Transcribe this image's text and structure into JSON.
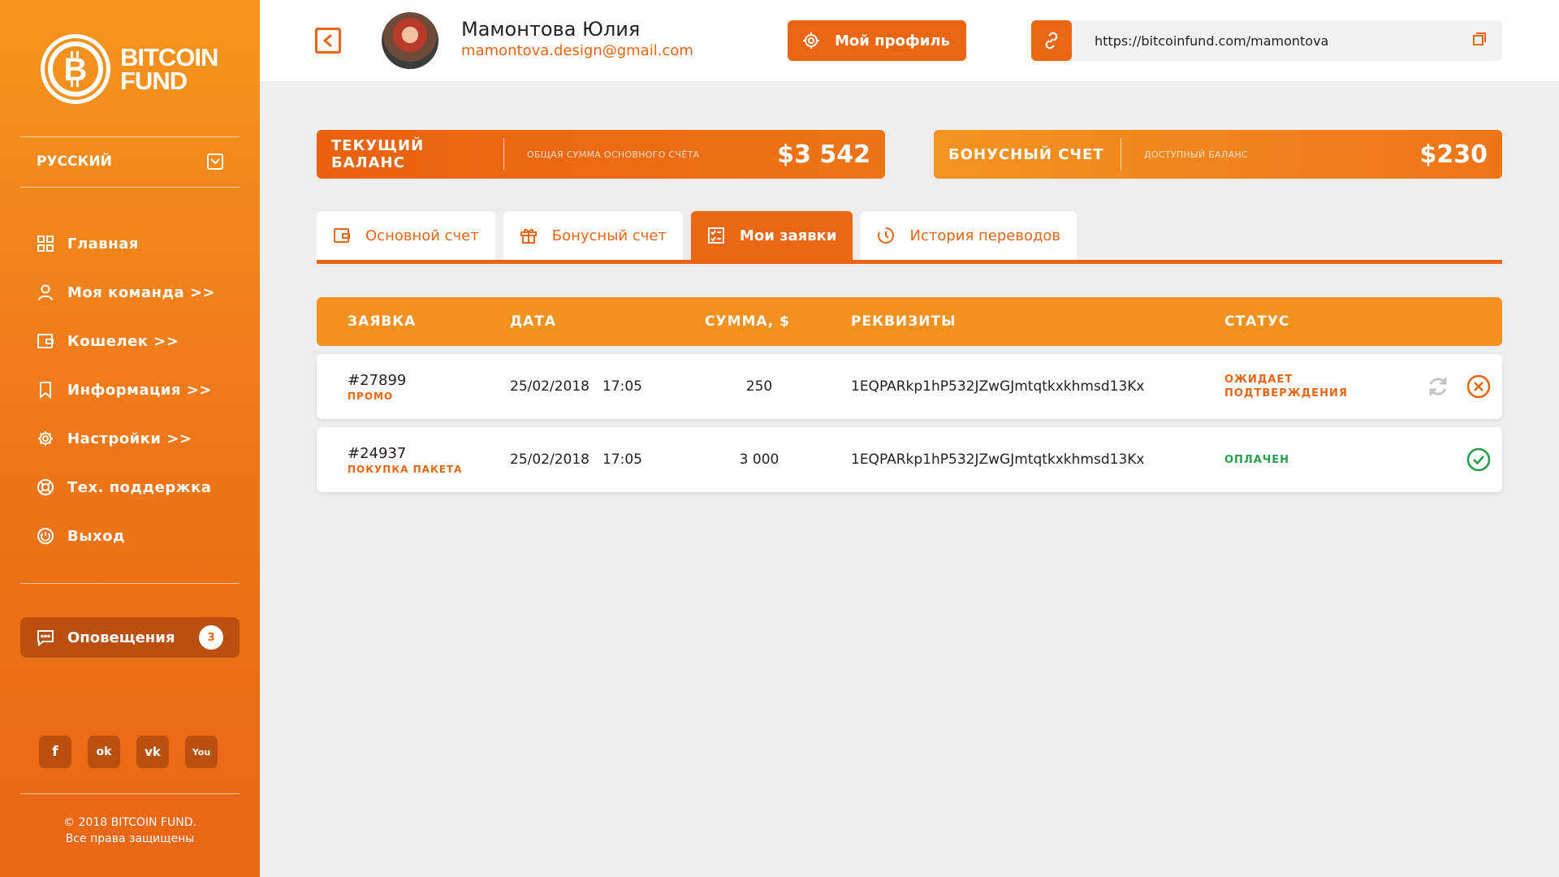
{
  "sidebar": {
    "logo_line1": "BITCOIN",
    "logo_line2": "FUND",
    "language": "РУССКИЙ",
    "nav": [
      {
        "label": "Главная",
        "icon": "grid-icon"
      },
      {
        "label": "Моя команда >>",
        "icon": "user-icon"
      },
      {
        "label": "Кошелек >>",
        "icon": "wallet-icon"
      },
      {
        "label": "Информация >>",
        "icon": "bookmark-icon"
      },
      {
        "label": "Настройки >>",
        "icon": "gear-icon"
      },
      {
        "label": "Тех. поддержка",
        "icon": "lifebuoy-icon"
      },
      {
        "label": "Выход",
        "icon": "power-icon"
      }
    ],
    "notifications_label": "Оповещения",
    "notifications_count": "3",
    "socials": [
      "f",
      "ok",
      "vk",
      "You"
    ],
    "copyright_line1": "© 2018 BITCOIN FUND.",
    "copyright_line2": "Все права защищены"
  },
  "header": {
    "user_name": "Мамонтова Юлия",
    "user_email": "mamontova.design@gmail.com",
    "profile_button": "Мой профиль",
    "ref_link": "https://bitcoinfund.com/mamontova"
  },
  "balances": {
    "main_title": "ТЕКУЩИЙ БАЛАНС",
    "main_sub": "ОБЩАЯ СУММА ОСНОВНОГО СЧЁТА",
    "main_amount": "$3 542",
    "bonus_title": "БОНУСНЫЙ СЧЕТ",
    "bonus_sub": "ДОСТУПНЫЙ БАЛАНС",
    "bonus_amount": "$230"
  },
  "tabs": [
    {
      "label": "Основной счет",
      "icon": "wallet-icon"
    },
    {
      "label": "Бонусный счет",
      "icon": "gift-icon"
    },
    {
      "label": "Мои заявки",
      "icon": "checklist-icon",
      "active": true
    },
    {
      "label": "История переводов",
      "icon": "clock-icon"
    }
  ],
  "table": {
    "headers": [
      "ЗАЯВКА",
      "ДАТА",
      "СУММА, $",
      "РЕКВИЗИТЫ",
      "СТАТУС"
    ],
    "rows": [
      {
        "id": "#27899",
        "type": "ПРОМО",
        "date": "25/02/2018",
        "time": "17:05",
        "amount": "250",
        "requisites": "1EQPARkp1hP532JZwGJmtqtkxkhmsd13Kx",
        "status_line1": "ОЖИДАЕТ",
        "status_line2": "ПОДТВЕРЖДЕНИЯ",
        "status": "pending"
      },
      {
        "id": "#24937",
        "type": "ПОКУПКА ПАКЕТА",
        "date": "25/02/2018",
        "time": "17:05",
        "amount": "3 000",
        "requisites": "1EQPARkp1hP532JZwGJmtqtkxkhmsd13Kx",
        "status_line1": "ОПЛАЧЕН",
        "status": "paid"
      }
    ]
  },
  "colors": {
    "accent": "#e96615",
    "accent_light": "#f39120",
    "paid": "#25a04a",
    "background": "#ededed"
  }
}
